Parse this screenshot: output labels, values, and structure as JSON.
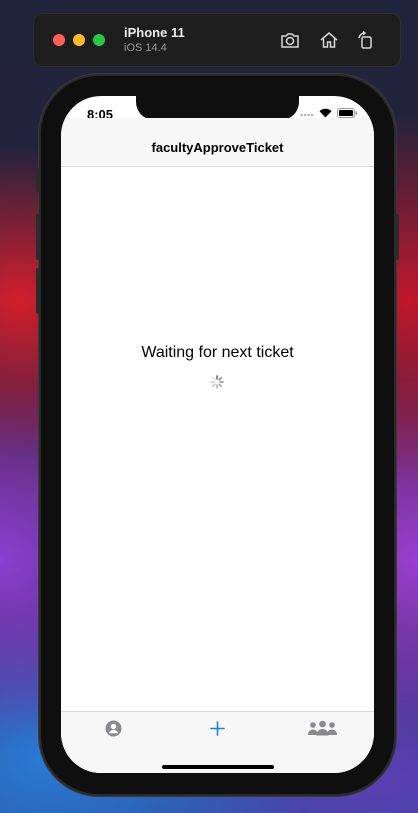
{
  "simulator": {
    "device_name": "iPhone 11",
    "os_version": "iOS 14.4",
    "buttons": [
      {
        "name": "screenshot-icon"
      },
      {
        "name": "home-icon"
      },
      {
        "name": "rotate-icon"
      }
    ]
  },
  "status_bar": {
    "time": "8:05",
    "icons": [
      "cellular-dots-icon",
      "wifi-icon",
      "battery-icon"
    ]
  },
  "navigation": {
    "title": "facultyApproveTicket"
  },
  "main": {
    "status_message": "Waiting for next ticket",
    "activity_indicator": "spinner-icon"
  },
  "tab_bar": {
    "tabs": [
      {
        "icon": "person-circle-icon",
        "selected": false
      },
      {
        "icon": "plus-icon",
        "selected": true
      },
      {
        "icon": "group-icon",
        "selected": false
      }
    ],
    "colors": {
      "selected": "#1a7fe0",
      "unselected": "#8a8a8e"
    }
  }
}
